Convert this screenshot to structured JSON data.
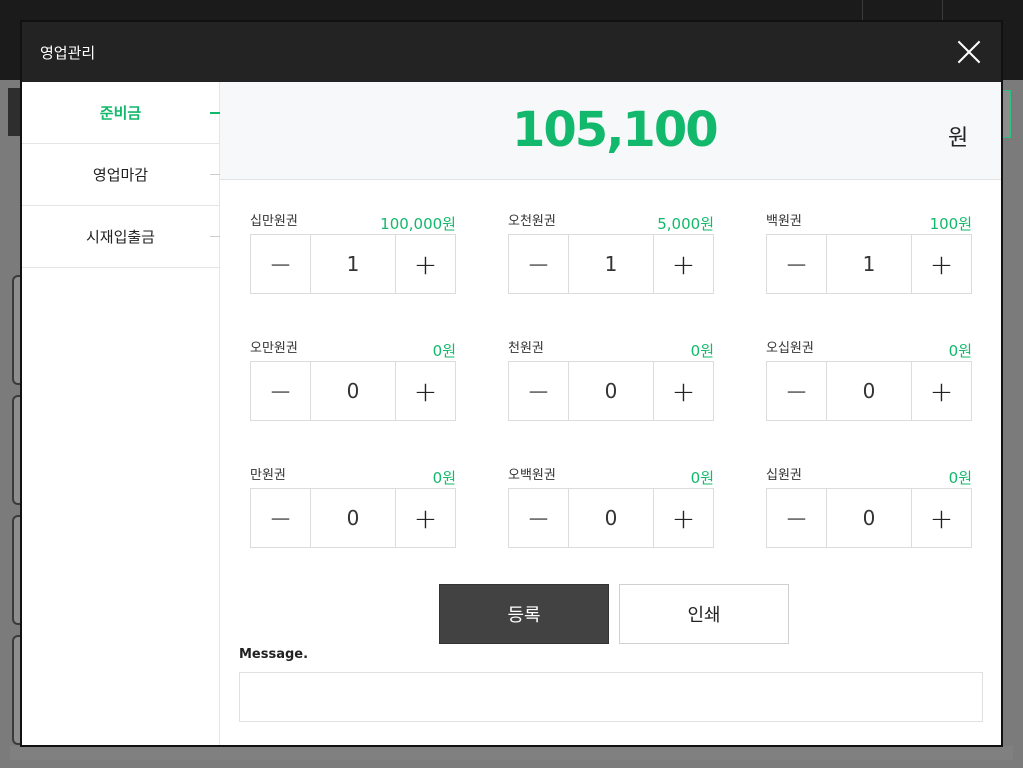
{
  "modal": {
    "title": "영업관리",
    "sidebar": [
      {
        "label": "준비금",
        "active": true
      },
      {
        "label": "영업마감",
        "active": false
      },
      {
        "label": "시재입출금",
        "active": false
      }
    ],
    "total": {
      "amount": "105,100",
      "unit": "원"
    },
    "denominations": [
      {
        "name": "십만원권",
        "amount": "100,000원",
        "qty": "1"
      },
      {
        "name": "오천원권",
        "amount": "5,000원",
        "qty": "1"
      },
      {
        "name": "백원권",
        "amount": "100원",
        "qty": "1"
      },
      {
        "name": "오만원권",
        "amount": "0원",
        "qty": "0"
      },
      {
        "name": "천원권",
        "amount": "0원",
        "qty": "0"
      },
      {
        "name": "오십원권",
        "amount": "0원",
        "qty": "0"
      },
      {
        "name": "만원권",
        "amount": "0원",
        "qty": "0"
      },
      {
        "name": "오백원권",
        "amount": "0원",
        "qty": "0"
      },
      {
        "name": "십원권",
        "amount": "0원",
        "qty": "0"
      }
    ],
    "stepper": {
      "minus": "−",
      "plus": "+"
    },
    "buttons": {
      "register": "등록",
      "print": "인쇄"
    },
    "message": {
      "label": "Message.",
      "value": ""
    }
  },
  "colors": {
    "accent": "#12b86b",
    "header": "#232323",
    "register_button": "#424242"
  },
  "icons": {
    "close": "close-icon"
  }
}
